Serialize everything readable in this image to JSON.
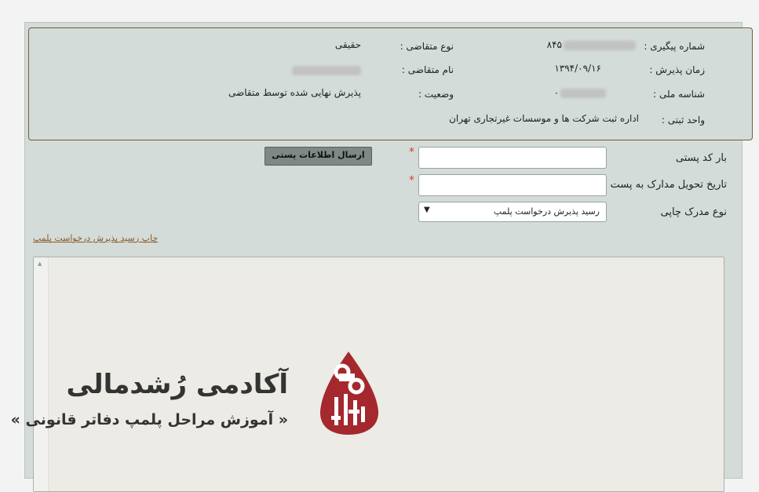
{
  "info": {
    "tracking_label": "شماره پیگیری :",
    "tracking_value": "۸۴۵",
    "applicant_type_label": "نوع متقاضی :",
    "applicant_type_value": "حقیقی",
    "reception_time_label": "زمان پذیرش :",
    "reception_time_value": "۱۳۹۴/۰۹/۱۶",
    "applicant_name_label": "نام متقاضی :",
    "national_id_label": "شناسه ملی :",
    "national_id_value": "۰",
    "status_label": "وضعیت :",
    "status_value": "پذیرش نهایی شده توسط متقاضی",
    "registration_unit_label": "واحد ثبتی :",
    "registration_unit_value": "اداره ثبت شرکت ها و موسسات غیرتجاری تهران"
  },
  "form": {
    "postal_code_label": "بار کد پستی",
    "postal_code_value": "",
    "delivery_date_label": "تاریخ تحویل مدارک به پست",
    "delivery_date_value": "",
    "doc_type_label": "نوع مدرک چاپی",
    "doc_type_selected": "رسید پذیرش درخواست پلمپ",
    "required_mark": "*",
    "send_button": "ارسال اطلاعات پستی",
    "print_link": "چاپ رسید پذیرش درخواست پلمپ"
  },
  "logo": {
    "title": "آکادمی رُشدمالی",
    "subtitle": "« آموزش مراحل پلمپ دفاتر قانونی »"
  },
  "colors": {
    "panel_bg": "#d3dcd8",
    "required": "#d93a2b",
    "link": "#8a5a2a",
    "logo_red": "#a4282d"
  }
}
